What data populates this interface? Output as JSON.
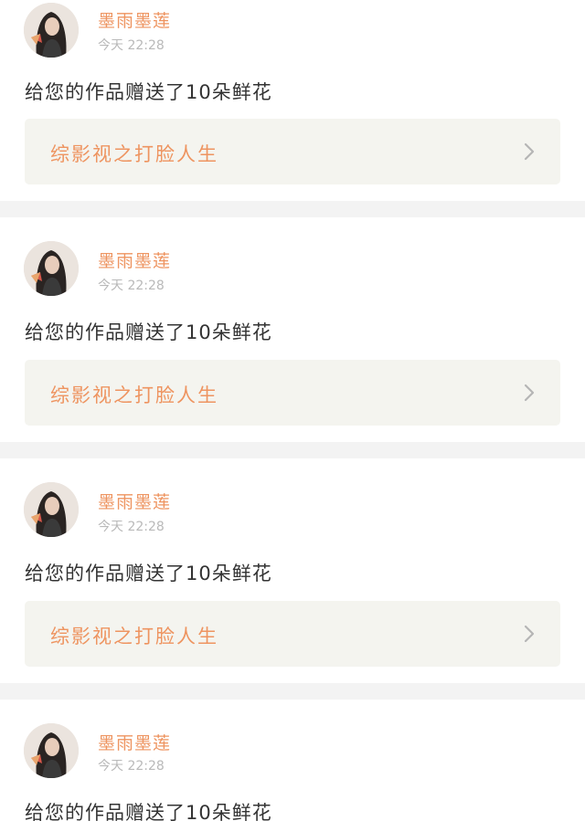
{
  "notifications": [
    {
      "username": "墨雨墨莲",
      "time": "今天 22:28",
      "message": "给您的作品赠送了10朵鲜花",
      "work_title": "综影视之打脸人生",
      "avatar_icon": "user-avatar-icon",
      "chevron_icon": "chevron-right-icon"
    },
    {
      "username": "墨雨墨莲",
      "time": "今天 22:28",
      "message": "给您的作品赠送了10朵鲜花",
      "work_title": "综影视之打脸人生",
      "avatar_icon": "user-avatar-icon",
      "chevron_icon": "chevron-right-icon"
    },
    {
      "username": "墨雨墨莲",
      "time": "今天 22:28",
      "message": "给您的作品赠送了10朵鲜花",
      "work_title": "综影视之打脸人生",
      "avatar_icon": "user-avatar-icon",
      "chevron_icon": "chevron-right-icon"
    },
    {
      "username": "墨雨墨莲",
      "time": "今天 22:28",
      "message": "给您的作品赠送了10朵鲜花",
      "avatar_icon": "user-avatar-icon"
    }
  ],
  "colors": {
    "accent": "#ee9460",
    "message_text": "#333333",
    "time_text": "#b9b9b9",
    "link_background": "#f4f4ef",
    "divider": "#f3f3f3"
  }
}
